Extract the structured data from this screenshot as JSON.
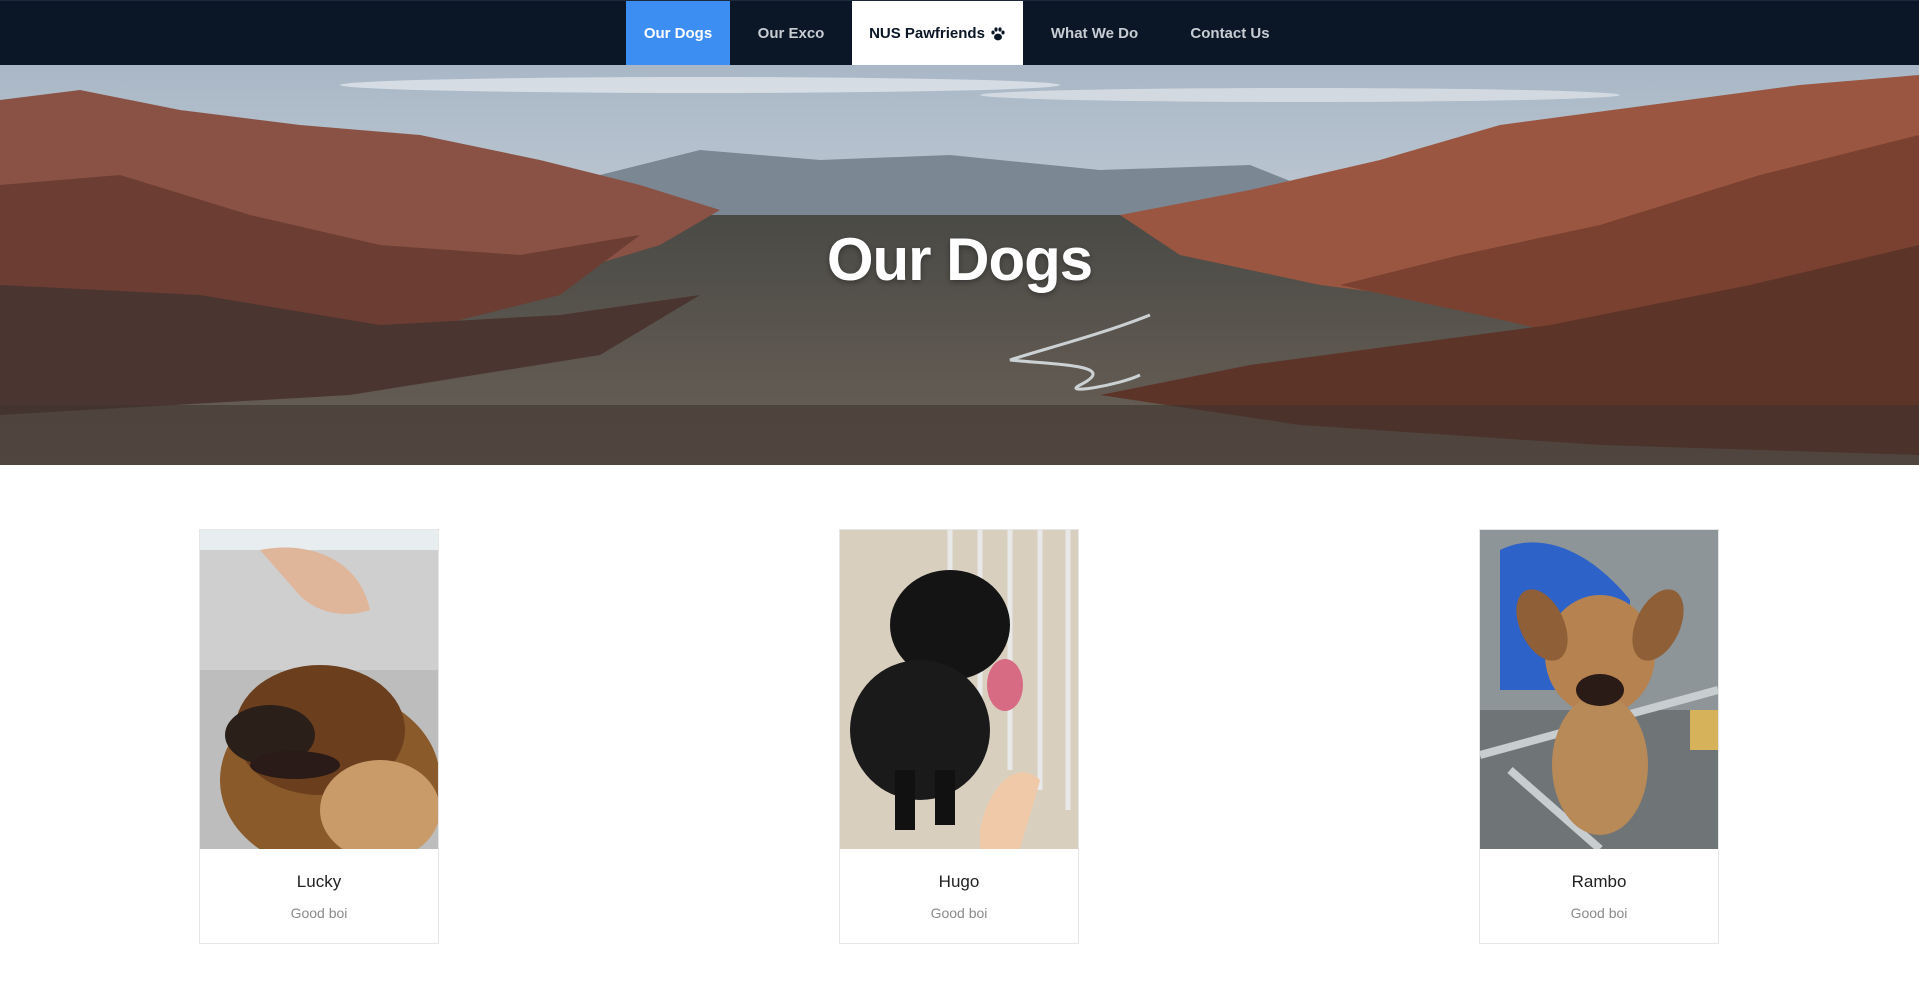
{
  "nav": {
    "items": [
      {
        "label": "Our Dogs",
        "active": true
      },
      {
        "label": "Our Exco",
        "active": false
      },
      {
        "label": "NUS Pawfriends",
        "brand": true,
        "icon": "paw-icon"
      },
      {
        "label": "What We Do",
        "active": false
      },
      {
        "label": "Contact Us",
        "active": false
      }
    ]
  },
  "hero": {
    "title": "Our Dogs"
  },
  "dogs": [
    {
      "name": "Lucky",
      "description": "Good boi"
    },
    {
      "name": "Hugo",
      "description": "Good boi"
    },
    {
      "name": "Rambo",
      "description": "Good boi"
    }
  ],
  "colors": {
    "navbar": "#0b1727",
    "active_tab": "#3d8ef3",
    "card_border": "#e6e6e6"
  }
}
